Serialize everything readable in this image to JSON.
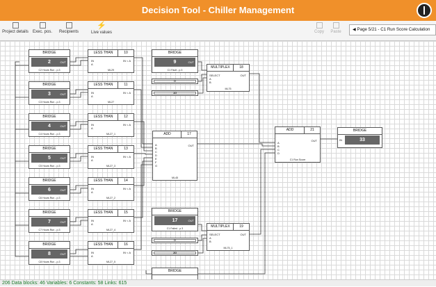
{
  "window": {
    "title": "Decision Tool - Chiller Management"
  },
  "toolbar": {
    "project_details": "Project details",
    "exec_pos": "Exec. pos.",
    "recipients": "Recipients",
    "live_values": "Live values",
    "copy": "Copy",
    "paste": "Paste",
    "page_selector": "Page 5/21 - C1 Run Score Calculation"
  },
  "status": {
    "text": "206   Data blocks: 46   Variables: 6   Constants: 58   Links: 615"
  },
  "bridges_left": [
    {
      "title": "BRIDGE",
      "value": "2",
      "out": "OUT",
      "caption": "C2 Hours Run - p.3"
    },
    {
      "title": "BRIDGE",
      "value": "3",
      "out": "OUT",
      "caption": "C3 Hours Run - p.3"
    },
    {
      "title": "BRIDGE",
      "value": "4",
      "out": "OUT",
      "caption": "C4 Hours Run - p.3"
    },
    {
      "title": "BRIDGE",
      "value": "5",
      "out": "OUT",
      "caption": "C5 Hours Run - p.3"
    },
    {
      "title": "BRIDGE",
      "value": "6",
      "out": "OUT",
      "caption": "C6 Hours Run - p.3"
    },
    {
      "title": "BRIDGE",
      "value": "7",
      "out": "OUT",
      "caption": "C7 Hours Run - p.3"
    },
    {
      "title": "BRIDGE",
      "value": "8",
      "out": "OUT",
      "caption": "C8 Hours Run - p.3"
    }
  ],
  "lessthan": [
    {
      "title": "LESS THAN",
      "num": "10",
      "in": "IN",
      "a": "A",
      "out": "IN < A",
      "foot": "ML29"
    },
    {
      "title": "LESS THAN",
      "num": "11",
      "in": "IN",
      "a": "A",
      "out": "IN < A",
      "foot": "ML27"
    },
    {
      "title": "LESS THAN",
      "num": "12",
      "in": "IN",
      "a": "A",
      "out": "IN < A",
      "foot": "ML27_1"
    },
    {
      "title": "LESS THAN",
      "num": "13",
      "in": "IN",
      "a": "A",
      "out": "IN < A",
      "foot": "ML27_3"
    },
    {
      "title": "LESS THAN",
      "num": "14",
      "in": "IN",
      "a": "A",
      "out": "IN < A",
      "foot": "ML27_2"
    },
    {
      "title": "LESS THAN",
      "num": "15",
      "in": "IN",
      "a": "A",
      "out": "IN < A",
      "foot": "ML27_4"
    },
    {
      "title": "LESS THAN",
      "num": "16",
      "in": "IN",
      "a": "A",
      "out": "IN < A",
      "foot": "ML27_5"
    }
  ],
  "bridge_fault": {
    "title": "BRIDGE",
    "value": "9",
    "out": "OUT",
    "caption": "C1 Fault - p.3"
  },
  "bridge_failed": {
    "title": "BRIDGE",
    "value": "17",
    "out": "OUT",
    "caption": "C1 Failed - p.3"
  },
  "bridge_bottom": {
    "title": "BRIDGE"
  },
  "constants_top": [
    "0",
    "10"
  ],
  "constants_bottom": [
    "0",
    "30"
  ],
  "multiplex1": {
    "title": "MULTIPLEX",
    "num": "18",
    "select": "SELECT",
    "a": "A",
    "b": "B",
    "out": "OUT",
    "foot": "ML75"
  },
  "multiplex2": {
    "title": "MULTIPLEX",
    "num": "19",
    "select": "SELECT",
    "a": "A",
    "b": "B",
    "out": "OUT",
    "foot": "ML75_1"
  },
  "add1": {
    "title": "ADD",
    "num": "17",
    "ports": [
      "A",
      "B",
      "C",
      "D",
      "E",
      "F",
      "G"
    ],
    "out": "OUT",
    "foot": "ML45"
  },
  "add2": {
    "title": "ADD",
    "num": "21",
    "ports": [
      "A",
      "B",
      "C",
      "D"
    ],
    "out": "OUT",
    "foot": "C1 Run Score"
  },
  "bridge_result": {
    "title": "BRIDGE",
    "value": "33",
    "in": "IN"
  }
}
